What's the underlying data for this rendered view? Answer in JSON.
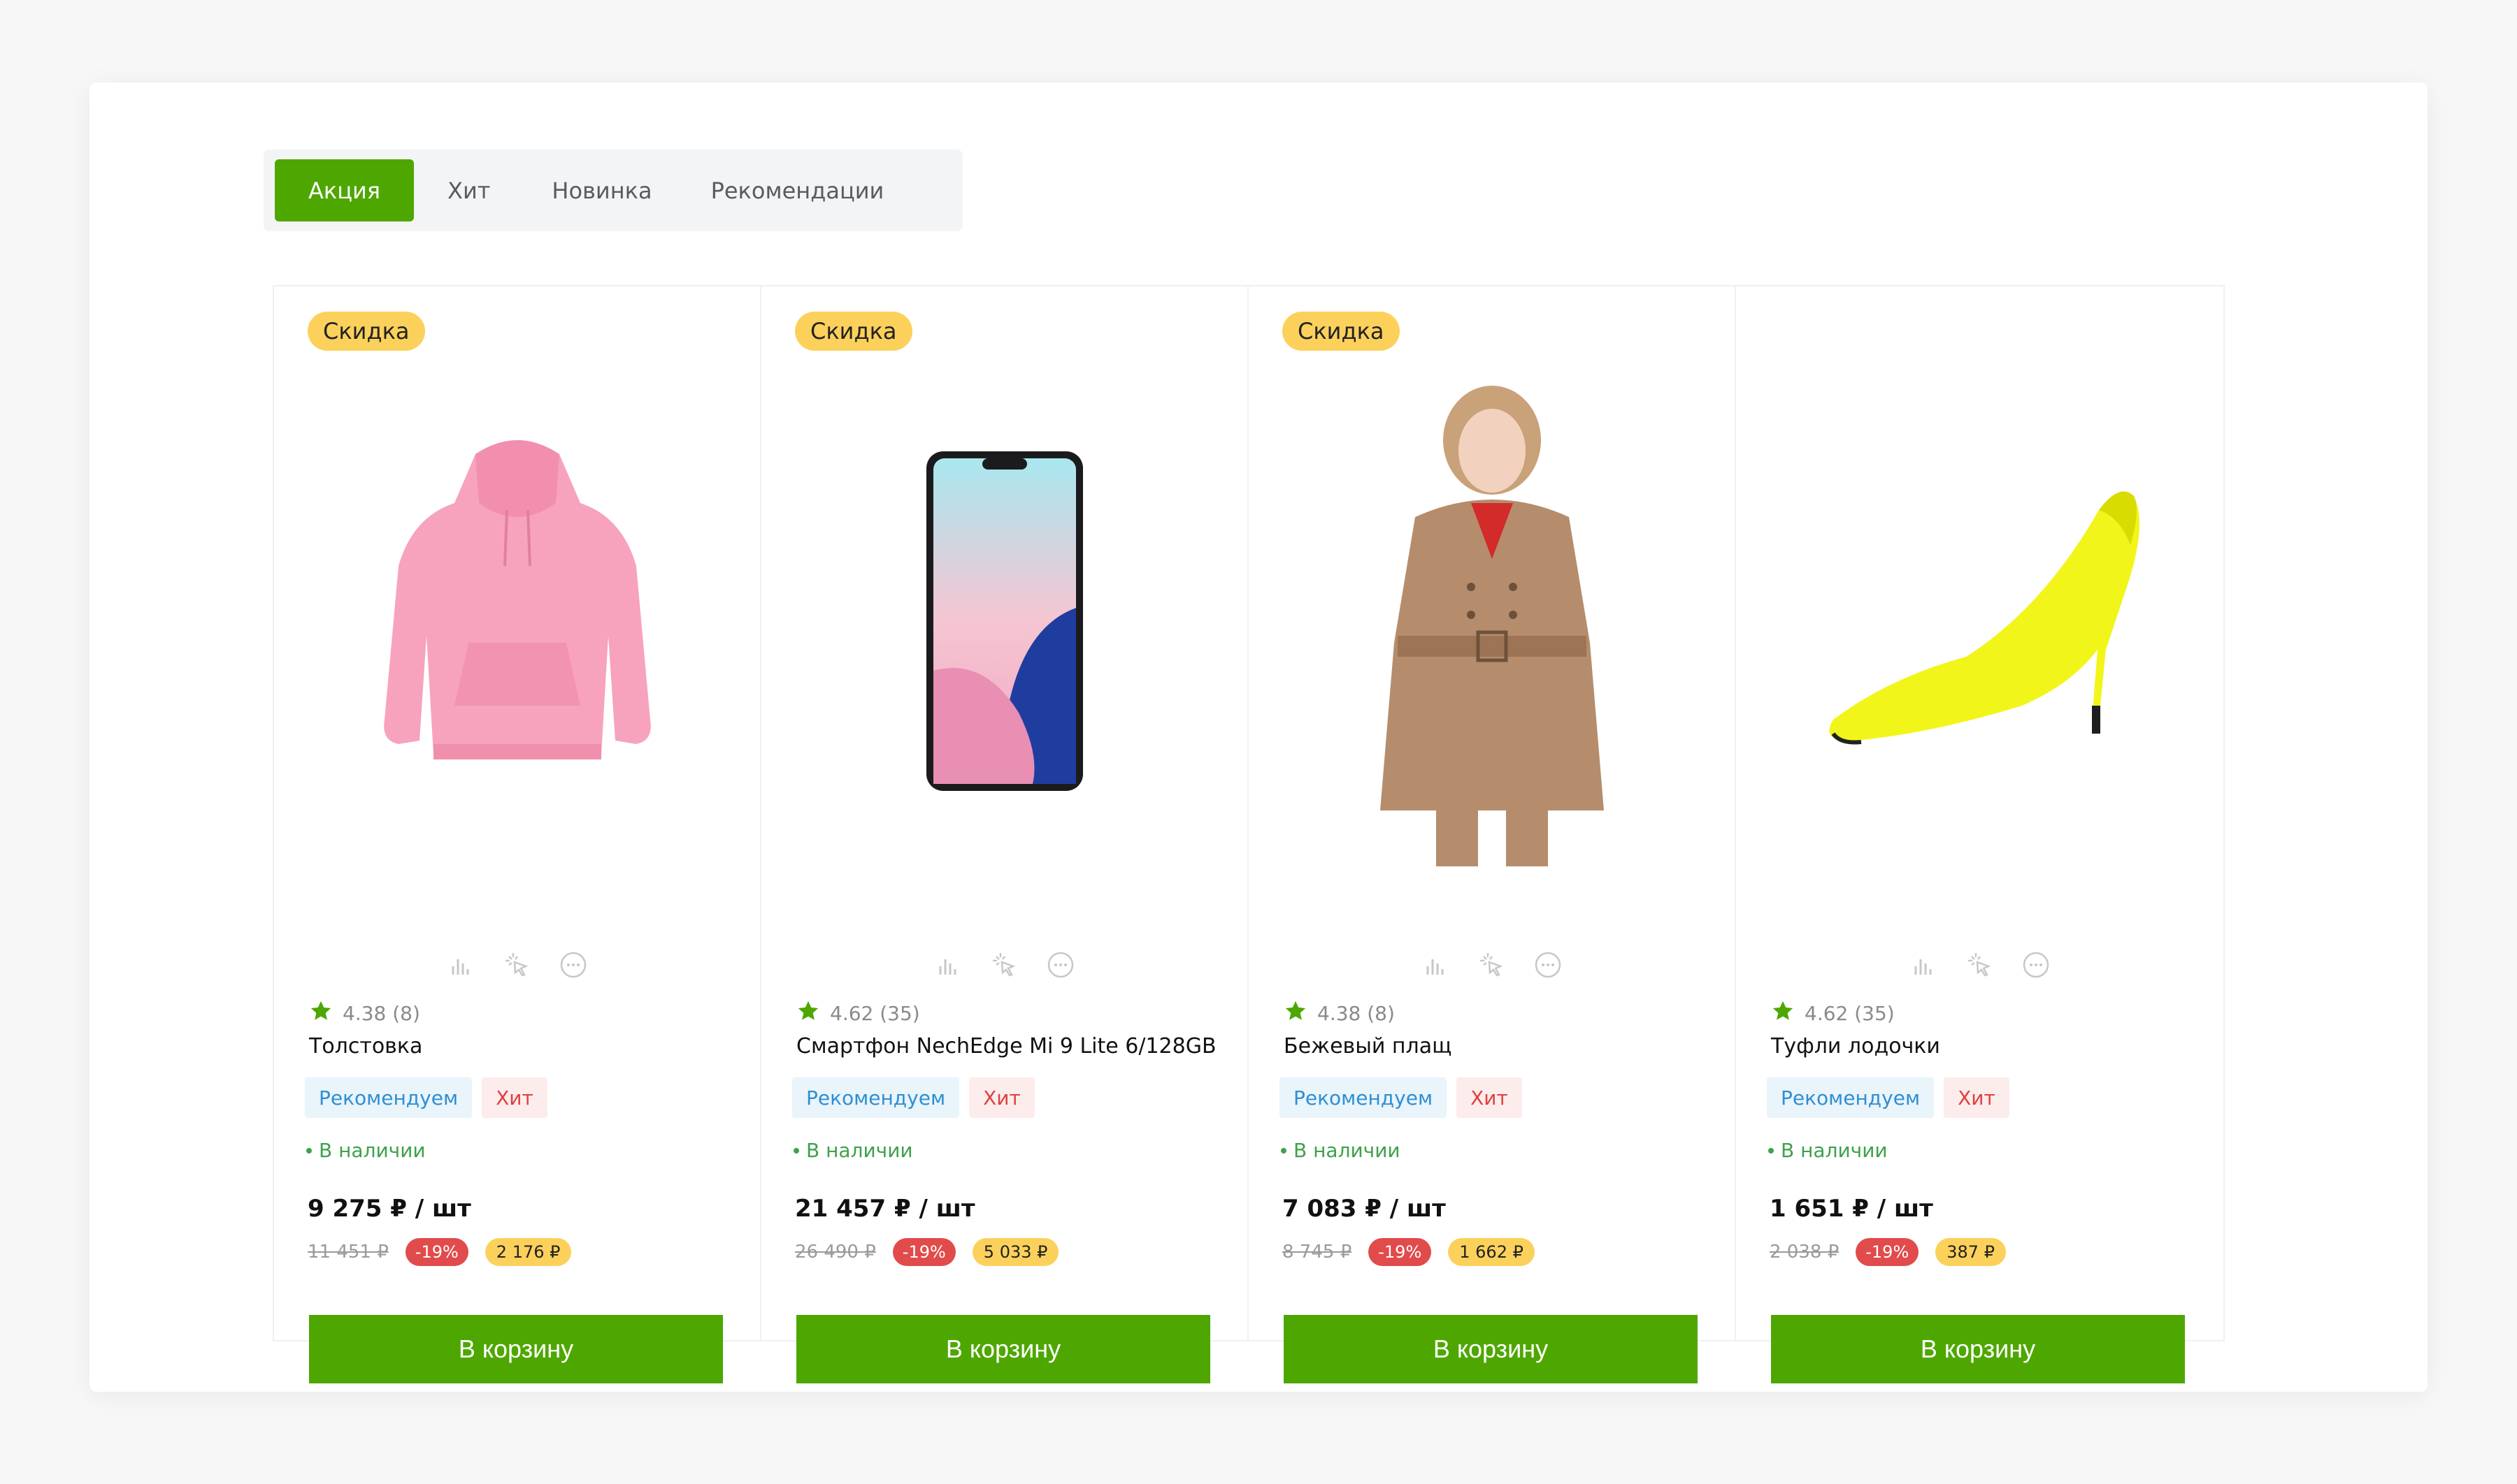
{
  "tabs": [
    {
      "label": "Акция",
      "active": true
    },
    {
      "label": "Хит",
      "active": false
    },
    {
      "label": "Новинка",
      "active": false
    },
    {
      "label": "Рекомендации",
      "active": false
    }
  ],
  "colors": {
    "accent": "#4ea700",
    "discount_badge": "#fcd15b",
    "percent_badge": "#e14b4b",
    "tag_rec": "#2f8fd1",
    "tag_hit": "#e03f3f",
    "in_stock": "#3fa14b"
  },
  "icons": {
    "compare": "bar-chart-icon",
    "quick_view": "cursor-click-icon",
    "more": "more-dots-icon",
    "rating": "star-icon"
  },
  "products": [
    {
      "badge": "Скидка",
      "image": "pink-hoodie",
      "rating": "4.38 (8)",
      "name": "Толстовка",
      "tag_rec": "Рекомендуем",
      "tag_hit": "Хит",
      "stock": "В наличии",
      "price": "9 275 ₽ / шт",
      "old_price": "11 451 ₽",
      "discount": "-19%",
      "saving": "2 176 ₽",
      "button": "В корзину"
    },
    {
      "badge": "Скидка",
      "image": "smartphone",
      "rating": "4.62 (35)",
      "name": "Смартфон NechEdge Mi 9 Lite 6/128GB",
      "tag_rec": "Рекомендуем",
      "tag_hit": "Хит",
      "stock": "В наличии",
      "price": "21 457 ₽ / шт",
      "old_price": "26 490 ₽",
      "discount": "-19%",
      "saving": "5 033 ₽",
      "button": "В корзину"
    },
    {
      "badge": "Скидка",
      "image": "beige-trench-coat",
      "rating": "4.38 (8)",
      "name": "Бежевый плащ",
      "tag_rec": "Рекомендуем",
      "tag_hit": "Хит",
      "stock": "В наличии",
      "price": "7 083 ₽ / шт",
      "old_price": "8 745 ₽",
      "discount": "-19%",
      "saving": "1 662 ₽",
      "button": "В корзину"
    },
    {
      "badge": "",
      "image": "yellow-pump-shoe",
      "rating": "4.62 (35)",
      "name": "Туфли лодочки",
      "tag_rec": "Рекомендуем",
      "tag_hit": "Хит",
      "stock": "В наличии",
      "price": "1 651 ₽ / шт",
      "old_price": "2 038 ₽",
      "discount": "-19%",
      "saving": "387 ₽",
      "button": "В корзину"
    }
  ]
}
